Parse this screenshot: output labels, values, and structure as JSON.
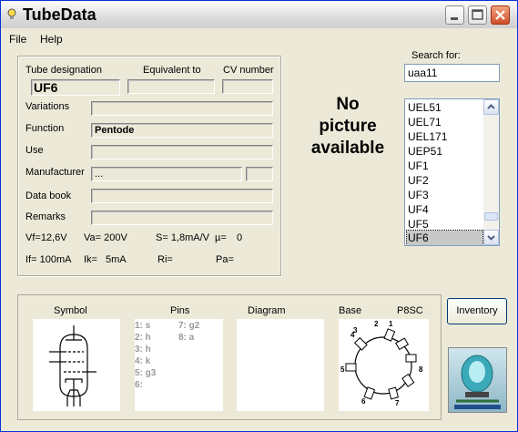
{
  "window": {
    "title": "TubeData"
  },
  "menu": {
    "file": "File",
    "help": "Help"
  },
  "form": {
    "labels": {
      "designation": "Tube designation",
      "equivalent": "Equivalent to",
      "cv": "CV number",
      "variations": "Variations",
      "function": "Function",
      "use": "Use",
      "manufacturer": "Manufacturer",
      "databook": "Data book",
      "remarks": "Remarks"
    },
    "values": {
      "designation": "UF6",
      "equivalent": "",
      "cv": "",
      "variations": "",
      "function": "Pentode",
      "use": "",
      "manufacturer": "...",
      "manufacturer_extra": "",
      "databook": "",
      "remarks": ""
    },
    "specs": {
      "vf": "Vf=12,6V",
      "va": "Va= 200V",
      "s": "S= 1,8mA/V",
      "mu": "µ=",
      "mu_val": "0",
      "if": "If= 100mA",
      "ik": "Ik=",
      "ik_val": "5mA",
      "ri": "Ri=",
      "pa": "Pa="
    }
  },
  "no_picture": {
    "line1": "No",
    "line2": "picture",
    "line3": "available"
  },
  "search": {
    "label": "Search for:",
    "value": "uaa11",
    "results": [
      "UEL51",
      "UEL71",
      "UEL171",
      "UEP51",
      "UF1",
      "UF2",
      "UF3",
      "UF4",
      "UF5",
      "UF6"
    ],
    "selected": "UF6"
  },
  "bottom": {
    "headers": {
      "symbol": "Symbol",
      "pins": "Pins",
      "diagram": "Diagram",
      "base": "Base",
      "base_type": "P8SC"
    },
    "pins_col1": [
      "1: s",
      "2: h",
      "3: h",
      "4: k",
      "5: g3",
      "6:"
    ],
    "pins_col2": [
      "7: g2",
      "8: a"
    ],
    "base_pins": [
      "1",
      "2",
      "3",
      "4",
      "5",
      "6",
      "7",
      "8"
    ]
  },
  "buttons": {
    "inventory": "Inventory"
  }
}
